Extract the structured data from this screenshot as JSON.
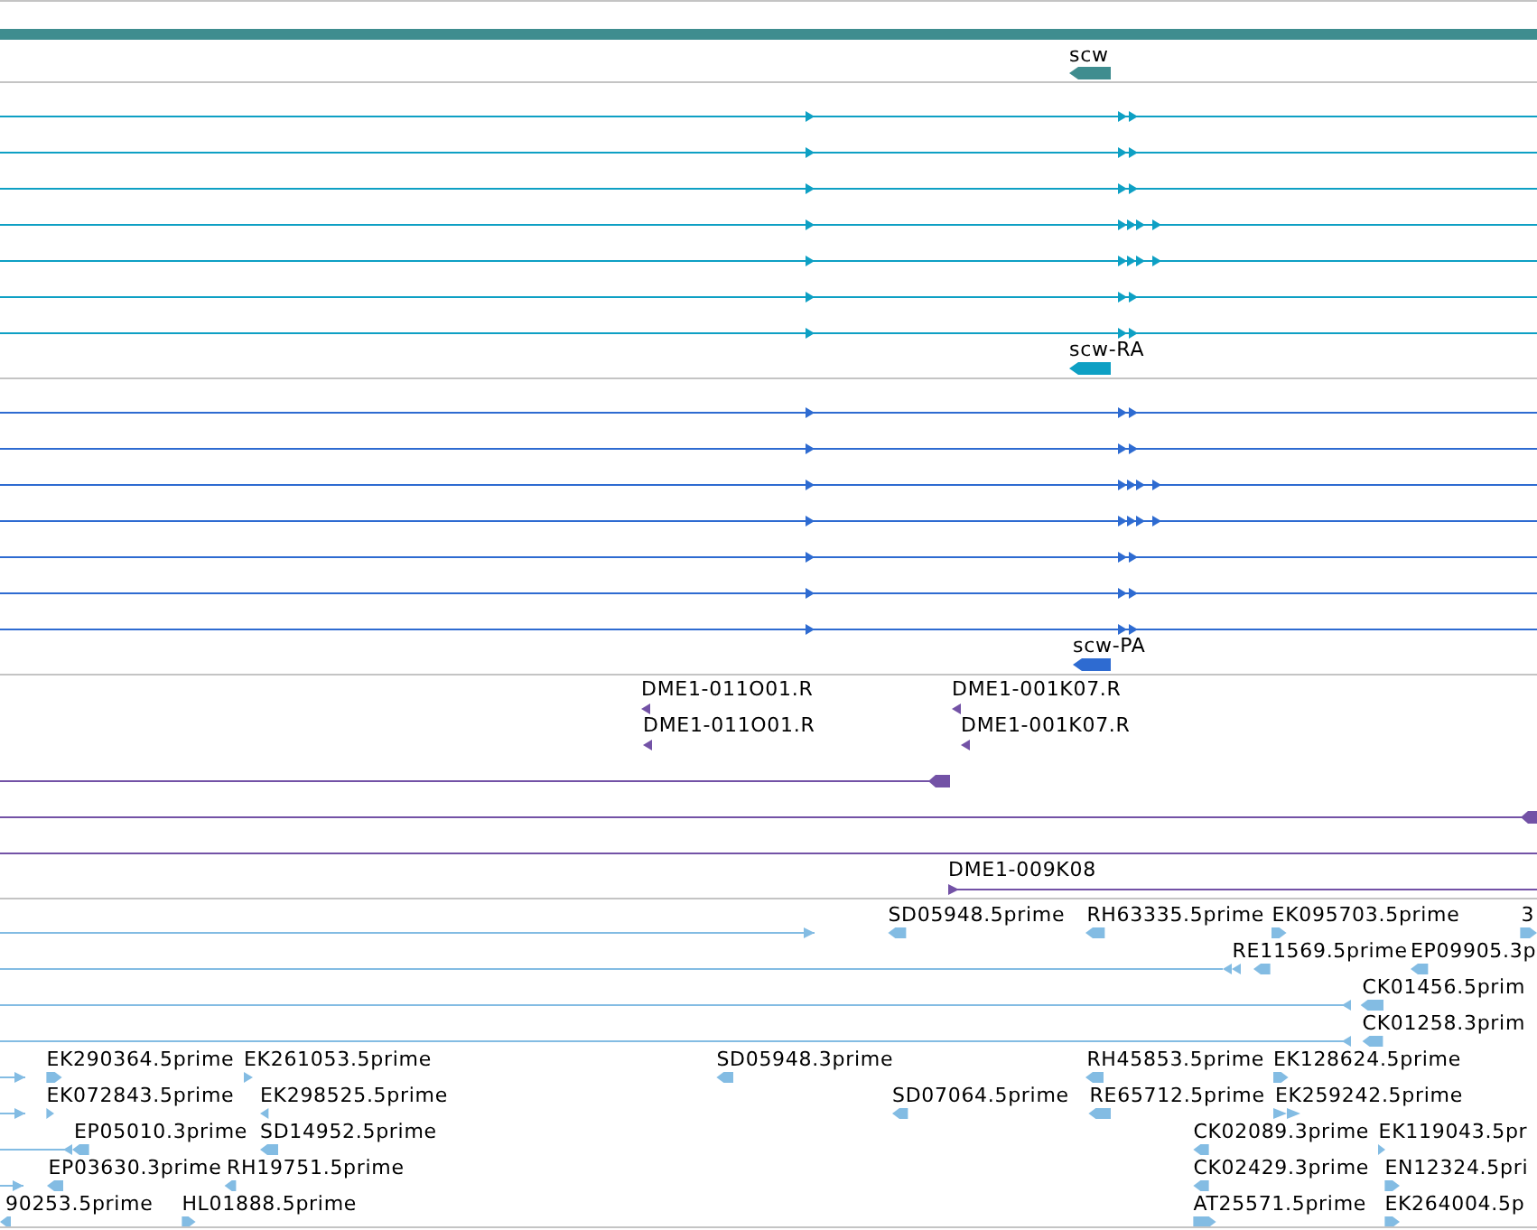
{
  "tracks": [
    {
      "kind": "gene",
      "color": "#3f8d8f",
      "features": [
        {
          "label": "scw",
          "reverse": true
        }
      ]
    },
    {
      "kind": "transcripts",
      "color": "#0ea0c4",
      "features": [
        {
          "label": "scw-RA",
          "reverse": true
        }
      ]
    },
    {
      "kind": "transcripts",
      "color": "#2e6bd1",
      "features": [
        {
          "label": "scw-PA",
          "reverse": true
        }
      ]
    },
    {
      "kind": "alignments",
      "color": "#7352a6",
      "features": [
        {
          "label": "DME1-011O01.R",
          "reverse": true
        },
        {
          "label": "DME1-001K07.R",
          "reverse": true
        },
        {
          "label": "DME1-011O01.R",
          "reverse": true
        },
        {
          "label": "DME1-001K07.R",
          "reverse": true
        },
        {
          "label": "DME1-009K08",
          "reverse": false
        }
      ]
    },
    {
      "kind": "alignments",
      "color": "#83bce3",
      "features": [
        {
          "label": "SD05948.5prime",
          "reverse": true
        },
        {
          "label": "RH63335.5prime",
          "reverse": true
        },
        {
          "label": "EK095703.5prime",
          "reverse": false
        },
        {
          "label": "3",
          "reverse": false
        },
        {
          "label": "RE11569.5prime",
          "reverse": true
        },
        {
          "label": "EP09905.3p",
          "reverse": true
        },
        {
          "label": "CK01456.5prim",
          "reverse": true
        },
        {
          "label": "CK01258.3prim",
          "reverse": true
        },
        {
          "label": "EK290364.5prime",
          "reverse": false
        },
        {
          "label": "EK261053.5prime",
          "reverse": false
        },
        {
          "label": "SD05948.3prime",
          "reverse": true
        },
        {
          "label": "RH45853.5prime",
          "reverse": true
        },
        {
          "label": "EK128624.5prime",
          "reverse": false
        },
        {
          "label": "EK072843.5prime",
          "reverse": false
        },
        {
          "label": "EK298525.5prime",
          "reverse": true
        },
        {
          "label": "SD07064.5prime",
          "reverse": true
        },
        {
          "label": "RE65712.5prime",
          "reverse": true
        },
        {
          "label": "EK259242.5prime",
          "reverse": false
        },
        {
          "label": "EP05010.3prime",
          "reverse": true
        },
        {
          "label": "SD14952.5prime",
          "reverse": true
        },
        {
          "label": "CK02089.3prime",
          "reverse": true
        },
        {
          "label": "EK119043.5pr",
          "reverse": false
        },
        {
          "label": "EP03630.3prime",
          "reverse": true
        },
        {
          "label": "RH19751.5prime",
          "reverse": true
        },
        {
          "label": "CK02429.3prime",
          "reverse": true
        },
        {
          "label": "EN12324.5pri",
          "reverse": false
        },
        {
          "label": "90253.5prime",
          "reverse": true
        },
        {
          "label": "HL01888.5prime",
          "reverse": false
        },
        {
          "label": "AT25571.5prime",
          "reverse": false
        },
        {
          "label": "EK264004.5p",
          "reverse": false
        }
      ]
    }
  ]
}
